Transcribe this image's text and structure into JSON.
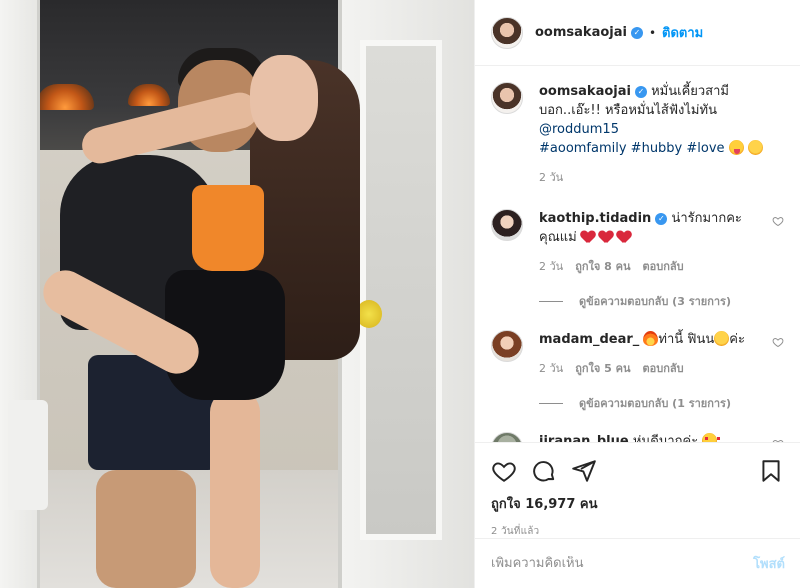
{
  "header": {
    "username": "oomsakaojai",
    "follow_label": "ติดตาม"
  },
  "caption": {
    "username": "oomsakaojai",
    "text": "หมั่นเคี้ยวสามีบอก..เอ๊ะ!! หรือหมั่นไส้ฟังไม่ทัน",
    "mention": "@roddum15",
    "hashtags": "#aoomfamily #hubby #love",
    "time": "2 วัน"
  },
  "comments": [
    {
      "username": "kaothip.tidadin",
      "text": "น่ารักมากคะ คุณแม่",
      "time": "2 วัน",
      "likes": "ถูกใจ 8 คน",
      "reply_label": "ตอบกลับ",
      "view_replies": "ดูข้อความตอบกลับ (3 รายการ)"
    },
    {
      "username": "madam_dear_",
      "text_before": "ท่านี้ ฟินน",
      "text_after": "ค่ะ",
      "time": "2 วัน",
      "likes": "ถูกใจ 5 คน",
      "reply_label": "ตอบกลับ",
      "view_replies": "ดูข้อความตอบกลับ (1 รายการ)"
    },
    {
      "username": "jiranan_blue",
      "text": "หุ่นดีมากค่ะ"
    }
  ],
  "actions": {
    "icons": [
      "heart-icon",
      "comment-icon",
      "share-icon",
      "save-icon"
    ]
  },
  "likes_text": "ถูกใจ 16,977 คน",
  "posted_ago": "2 วันที่แล้ว",
  "add_comment": {
    "placeholder": "เพิ่มความคิดเห็น",
    "post_label": "โพสต์"
  },
  "colors": {
    "link_blue": "#0095f6",
    "verified_blue": "#3897f0",
    "post_disabled": "#b2dffc",
    "muted": "#8e8e8e"
  }
}
